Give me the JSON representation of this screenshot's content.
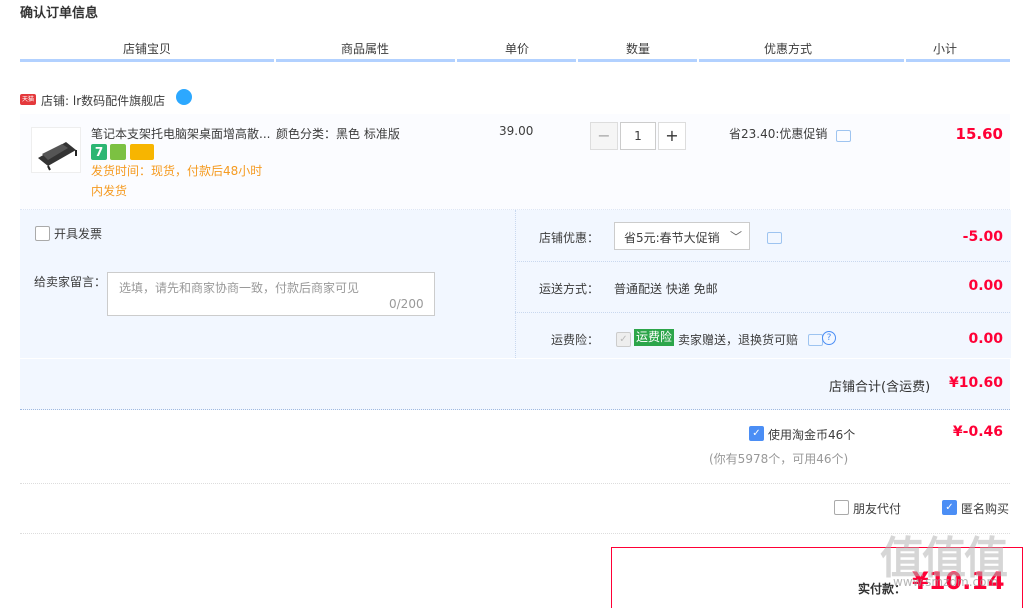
{
  "title": "确认订单信息",
  "columns": [
    "店铺宝贝",
    "商品属性",
    "单价",
    "数量",
    "优惠方式",
    "小计"
  ],
  "shop": {
    "badge": "天猫",
    "label": "店铺: lr数码配件旗舰店"
  },
  "item": {
    "title": "笔记本支架托电脑架桌面增高散...",
    "attr": "颜色分类：黑色 标准版",
    "price": "39.00",
    "ship_line1": "发货时间：现货，付款后48小时",
    "ship_line2": "内发货",
    "qty": "1",
    "qty_minus": "−",
    "qty_plus": "+",
    "promo": "省23.40:优惠促销",
    "subtotal": "15.60"
  },
  "invoice": {
    "label": "开具发票"
  },
  "memo": {
    "label": "给卖家留言：",
    "placeholder": "选填，请先和商家协商一致，付款后商家可见",
    "count": "0/200"
  },
  "shop_discount": {
    "label": "店铺优惠：",
    "selected": "省5元:春节大促销",
    "amount": "-5.00"
  },
  "shipping": {
    "label": "运送方式：",
    "value": "普通配送 快递 免邮",
    "amount": "0.00"
  },
  "insurance": {
    "label": "运费险：",
    "tag": "运费险",
    "value": "卖家赠送，退换货可赔",
    "amount": "0.00"
  },
  "shop_total": {
    "label": "店铺合计(含运费)",
    "amount": "¥10.60"
  },
  "coins": {
    "label": "使用淘金币46个",
    "amount": "¥-0.46",
    "note": "(你有5978个，可用46个)"
  },
  "options": {
    "friend_pay": "朋友代付",
    "anonymous": "匿名购买"
  },
  "pay": {
    "label": "实付款：",
    "amount": "¥10.14"
  },
  "watermark": {
    "text": "值值值",
    "url": "www.smzdm.com"
  },
  "colors": {
    "accent": "#ff0036",
    "header_line": "#b2d1ff",
    "light_bg": "#f2f7ff",
    "checkbox": "#4b8ef5",
    "ship_text": "#f59b21"
  }
}
